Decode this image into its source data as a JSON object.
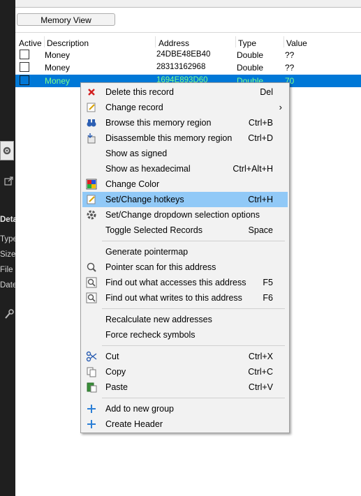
{
  "left_panel": {
    "labels": [
      "Deta",
      "Type",
      "Size",
      "File l",
      "Date"
    ]
  },
  "memory_view_button": "Memory View",
  "table": {
    "headers": {
      "active": "Active",
      "description": "Description",
      "address": "Address",
      "type": "Type",
      "value": "Value"
    },
    "rows": [
      {
        "description": "Money",
        "address": "24DBE48EB40",
        "type": "Double",
        "value": "??"
      },
      {
        "description": "Money",
        "address": "28313162968",
        "type": "Double",
        "value": "??"
      },
      {
        "description": "Money",
        "address": "1694E893D60",
        "type": "Double",
        "value": "70"
      }
    ]
  },
  "context_menu": {
    "items": [
      {
        "label": "Delete this record",
        "shortcut": "Del",
        "icon": "delete-x-icon"
      },
      {
        "label": "Change record",
        "shortcut": "",
        "icon": "edit-record-icon",
        "submenu": true
      },
      {
        "label": "Browse this memory region",
        "shortcut": "Ctrl+B",
        "icon": "binoculars-icon"
      },
      {
        "label": "Disassemble this memory region",
        "shortcut": "Ctrl+D",
        "icon": "disassemble-icon"
      },
      {
        "label": "Show as signed",
        "shortcut": ""
      },
      {
        "label": "Show as hexadecimal",
        "shortcut": "Ctrl+Alt+H"
      },
      {
        "label": "Change Color",
        "shortcut": "",
        "icon": "color-palette-icon"
      },
      {
        "label": "Set/Change hotkeys",
        "shortcut": "Ctrl+H",
        "icon": "hotkey-icon",
        "highlighted": true
      },
      {
        "label": "Set/Change dropdown selection options",
        "shortcut": "",
        "icon": "gear-icon"
      },
      {
        "label": "Toggle Selected Records",
        "shortcut": "Space"
      },
      {
        "label": "Generate pointermap",
        "shortcut": ""
      },
      {
        "label": "Pointer scan for this address",
        "shortcut": "",
        "icon": "magnifier-icon"
      },
      {
        "label": "Find out what accesses this address",
        "shortcut": "F5",
        "icon": "find-access-icon"
      },
      {
        "label": "Find out what writes to this address",
        "shortcut": "F6",
        "icon": "find-write-icon"
      },
      {
        "label": "Recalculate new addresses",
        "shortcut": ""
      },
      {
        "label": "Force recheck symbols",
        "shortcut": ""
      },
      {
        "label": "Cut",
        "shortcut": "Ctrl+X",
        "icon": "scissors-icon"
      },
      {
        "label": "Copy",
        "shortcut": "Ctrl+C",
        "icon": "copy-icon"
      },
      {
        "label": "Paste",
        "shortcut": "Ctrl+V",
        "icon": "paste-icon"
      },
      {
        "label": "Add to new group",
        "shortcut": "",
        "icon": "plus-icon"
      },
      {
        "label": "Create Header",
        "shortcut": "",
        "icon": "plus-icon"
      }
    ]
  },
  "colors": {
    "selection": "#0078d7",
    "selected_text": "#7dff8a",
    "menu_highlight": "#91c9f7",
    "menu_bg": "#f2f2f2"
  }
}
